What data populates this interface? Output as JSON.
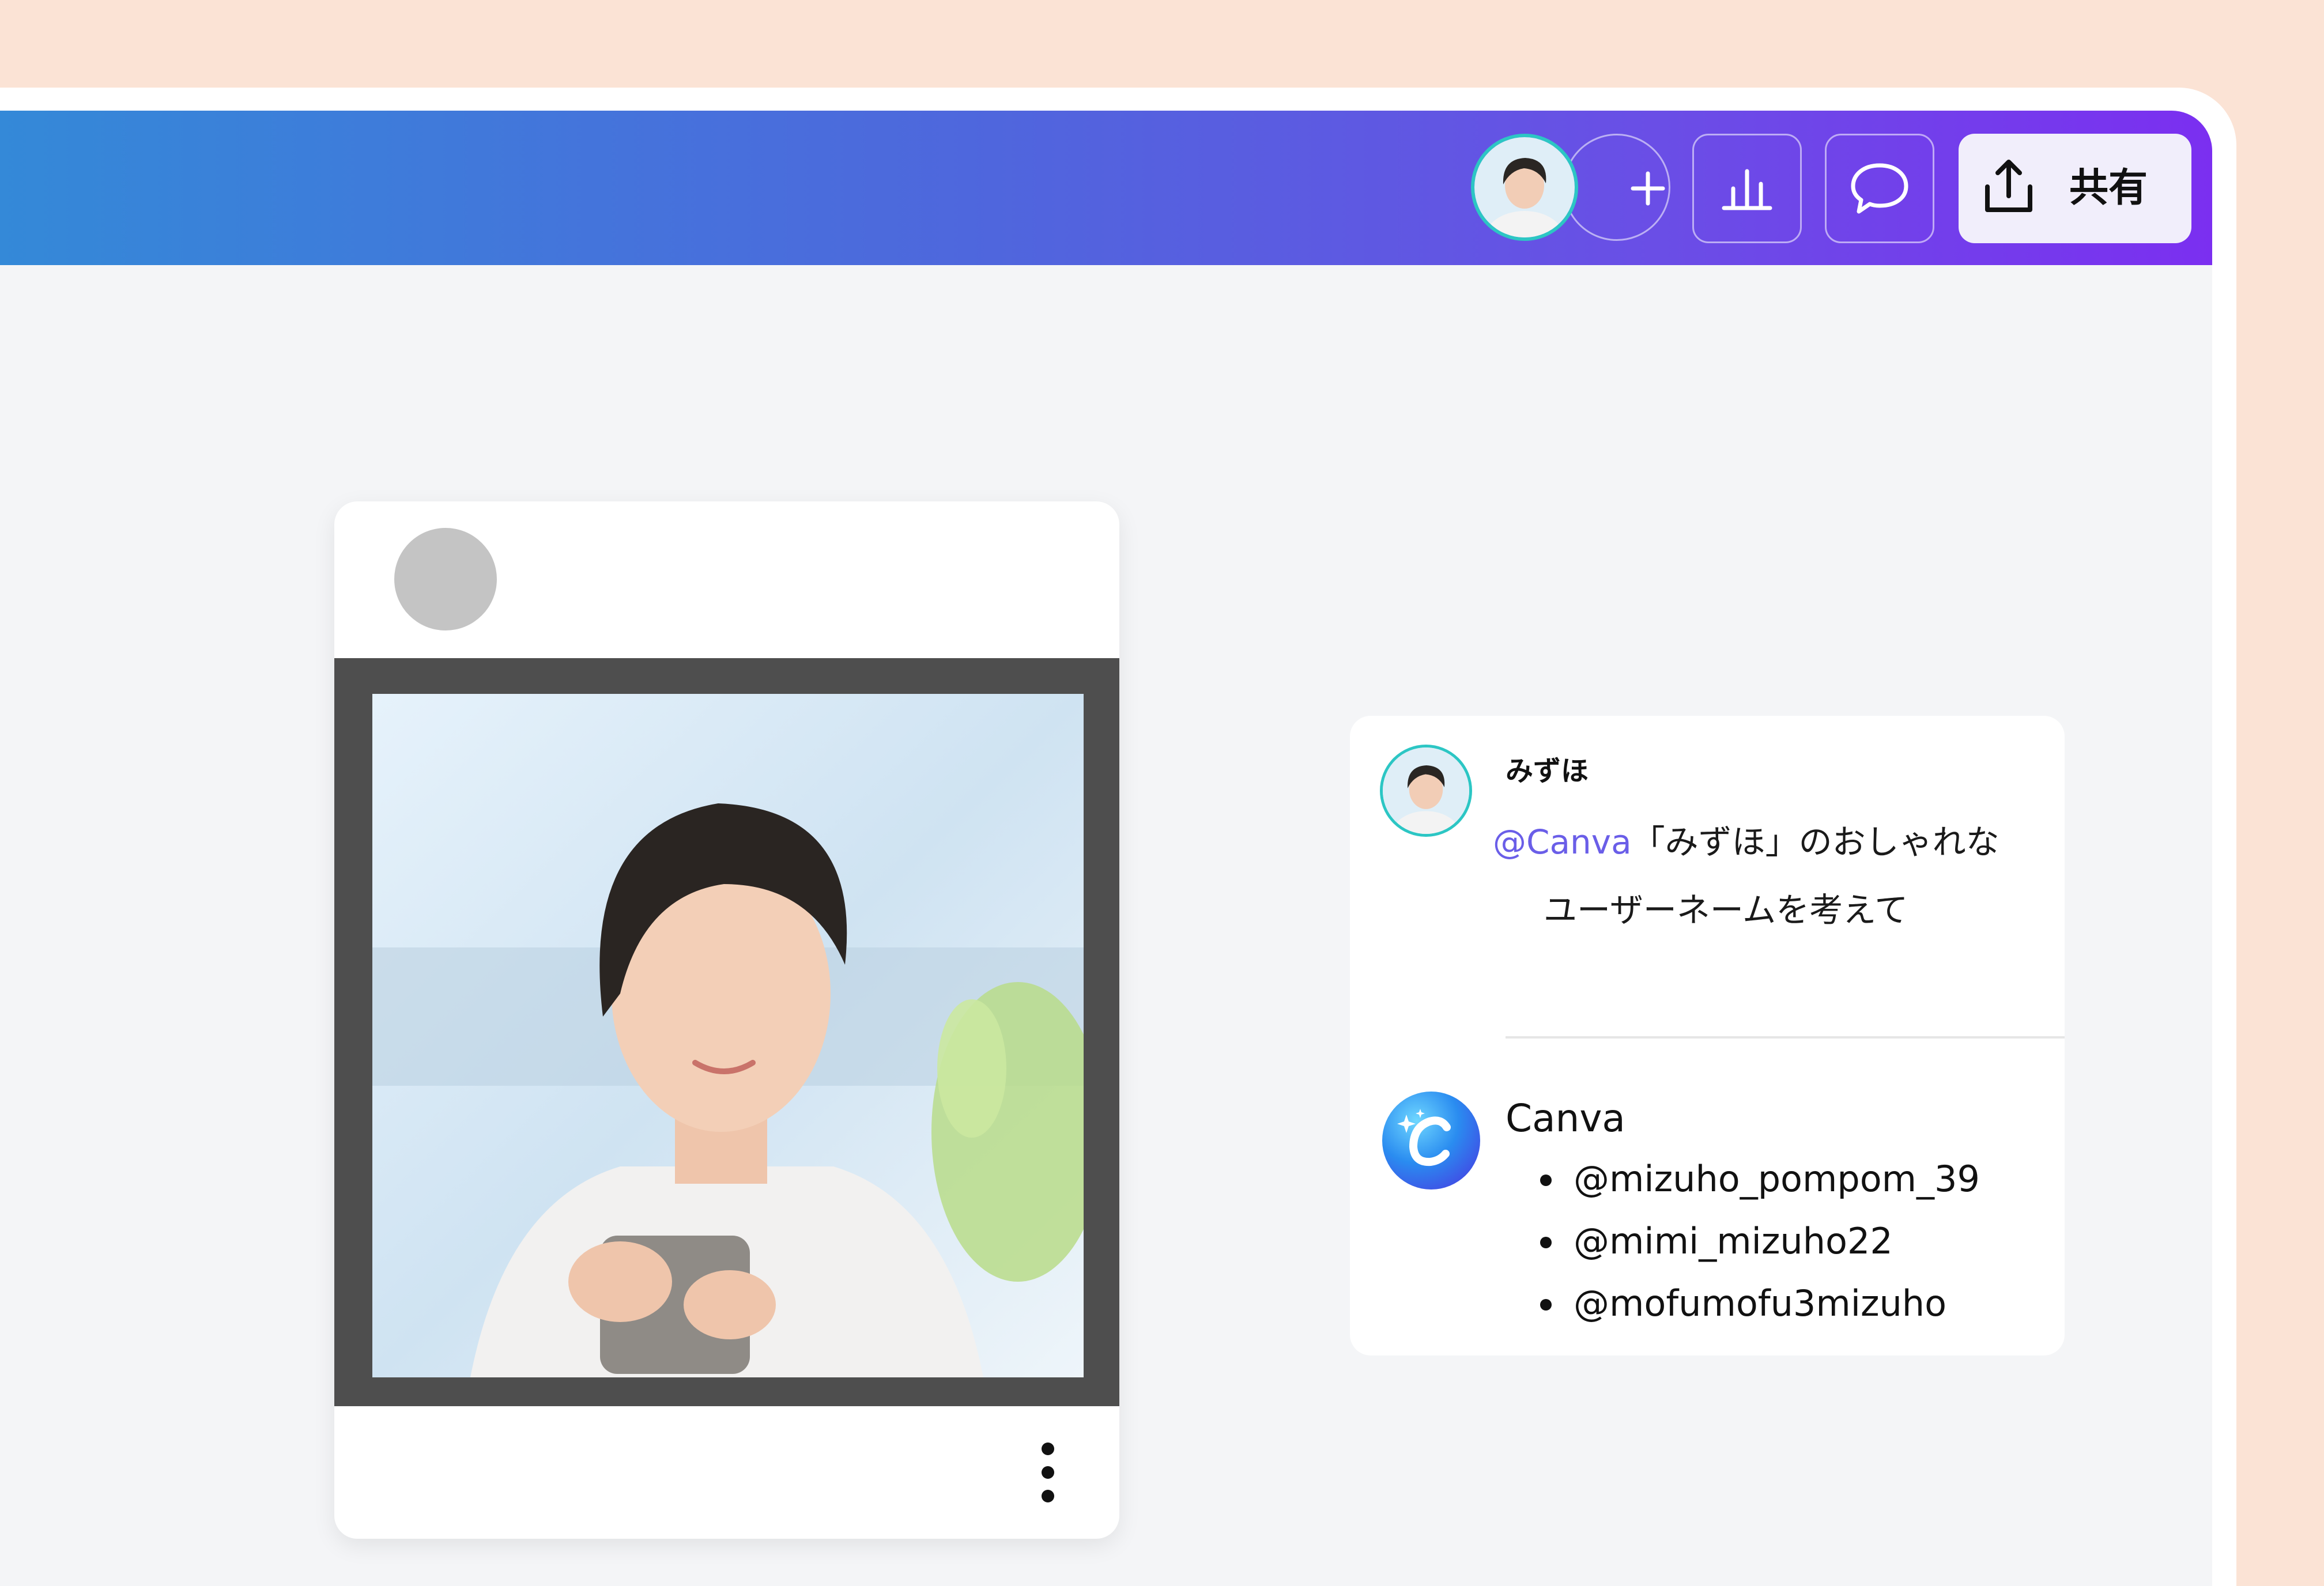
{
  "toolbar": {
    "share_label": "共有",
    "icons": [
      "collaborator-avatar",
      "add-icon",
      "insights-icon",
      "comment-icon",
      "share-upload-icon"
    ],
    "gradient_colors": [
      "#3489d8",
      "#7b2ff0"
    ]
  },
  "post": {
    "photo": "woman-holding-mug",
    "icons": [
      "more-vertical-icon"
    ]
  },
  "comment": {
    "author": "みずほ",
    "mention": "@Canva",
    "text_line1": "「みずほ」のおしゃれな",
    "text_line2": "ユーザーネームを考えて"
  },
  "reply": {
    "author": "Canva",
    "suggestions": [
      "@mizuho_pompom_39",
      "@mimi_mizuho22",
      "@mofumofu3mizuho"
    ]
  },
  "colors": {
    "background": "#fbe3d5",
    "mention": "#6a5ee8",
    "avatar_ring": "#2cc6c4"
  }
}
